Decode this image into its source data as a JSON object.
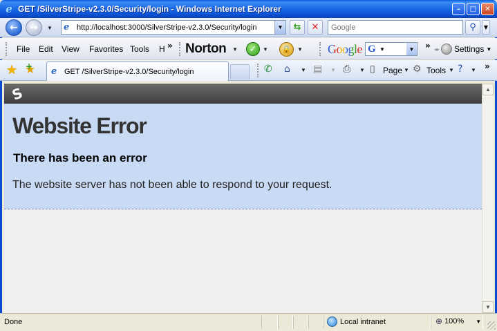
{
  "window": {
    "title": "GET /SilverStripe-v2.3.0/Security/login - Windows Internet Explorer"
  },
  "address_bar": {
    "url": "http://localhost:3000/SilverStripe-v2.3.0/Security/login",
    "search_placeholder": "Google"
  },
  "menu": {
    "items": [
      "File",
      "Edit",
      "View",
      "Favorites",
      "Tools",
      "H"
    ],
    "norton_label": "Norton",
    "google_label": "Google",
    "settings_label": "Settings"
  },
  "tabs": [
    {
      "label": "GET /SilverStripe-v2.3.0/Security/login"
    }
  ],
  "command_bar": {
    "page_label": "Page",
    "tools_label": "Tools"
  },
  "page": {
    "title": "Website Error",
    "subtitle": "There has been an error",
    "message": "The website server has not been able to respond to your request."
  },
  "status_bar": {
    "status": "Done",
    "zone": "Local intranet",
    "zoom": "100%"
  },
  "colors": {
    "titlebar": "#0b4fd0",
    "error_panel": "#c9dbf4",
    "header_bar": "#4a4a4a"
  }
}
